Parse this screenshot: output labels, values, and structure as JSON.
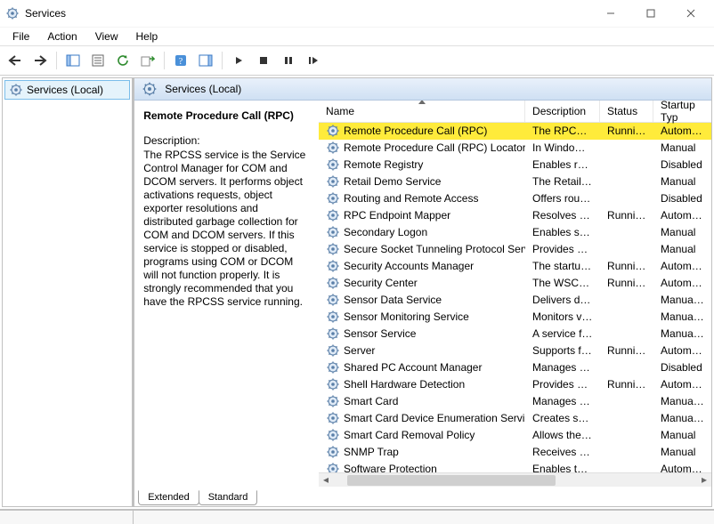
{
  "window": {
    "title": "Services"
  },
  "menu": {
    "file": "File",
    "action": "Action",
    "view": "View",
    "help": "Help"
  },
  "tree": {
    "root": "Services (Local)"
  },
  "detailHeader": {
    "label": "Services (Local)"
  },
  "info": {
    "title": "Remote Procedure Call (RPC)",
    "descLabel": "Description:",
    "descText": "The RPCSS service is the Service Control Manager for COM and DCOM servers. It performs object activations requests, object exporter resolutions and distributed garbage collection for COM and DCOM servers. If this service is stopped or disabled, programs using COM or DCOM will not function properly. It is strongly recommended that you have the RPCSS service running."
  },
  "columns": {
    "name": "Name",
    "description": "Description",
    "status": "Status",
    "startup": "Startup Typ"
  },
  "services": [
    {
      "name": "Remote Procedure Call (RPC)",
      "desc": "The RPCSS s...",
      "status": "Running",
      "startup": "Automatic",
      "selected": true
    },
    {
      "name": "Remote Procedure Call (RPC) Locator",
      "desc": "In Windows...",
      "status": "",
      "startup": "Manual"
    },
    {
      "name": "Remote Registry",
      "desc": "Enables rem...",
      "status": "",
      "startup": "Disabled"
    },
    {
      "name": "Retail Demo Service",
      "desc": "The Retail D...",
      "status": "",
      "startup": "Manual"
    },
    {
      "name": "Routing and Remote Access",
      "desc": "Offers routi...",
      "status": "",
      "startup": "Disabled"
    },
    {
      "name": "RPC Endpoint Mapper",
      "desc": "Resolves RP...",
      "status": "Running",
      "startup": "Automatic"
    },
    {
      "name": "Secondary Logon",
      "desc": "Enables star...",
      "status": "",
      "startup": "Manual"
    },
    {
      "name": "Secure Socket Tunneling Protocol Serv...",
      "desc": "Provides su...",
      "status": "",
      "startup": "Manual"
    },
    {
      "name": "Security Accounts Manager",
      "desc": "The startup ...",
      "status": "Running",
      "startup": "Automatic"
    },
    {
      "name": "Security Center",
      "desc": "The WSCSV...",
      "status": "Running",
      "startup": "Automatic"
    },
    {
      "name": "Sensor Data Service",
      "desc": "Delivers dat...",
      "status": "",
      "startup": "Manual (Tr"
    },
    {
      "name": "Sensor Monitoring Service",
      "desc": "Monitors va...",
      "status": "",
      "startup": "Manual (Tr"
    },
    {
      "name": "Sensor Service",
      "desc": "A service fo...",
      "status": "",
      "startup": "Manual (Tr"
    },
    {
      "name": "Server",
      "desc": "Supports fil...",
      "status": "Running",
      "startup": "Automatic"
    },
    {
      "name": "Shared PC Account Manager",
      "desc": "Manages pr...",
      "status": "",
      "startup": "Disabled"
    },
    {
      "name": "Shell Hardware Detection",
      "desc": "Provides no...",
      "status": "Running",
      "startup": "Automatic"
    },
    {
      "name": "Smart Card",
      "desc": "Manages ac...",
      "status": "",
      "startup": "Manual (Tr"
    },
    {
      "name": "Smart Card Device Enumeration Service",
      "desc": "Creates soft...",
      "status": "",
      "startup": "Manual (Tr"
    },
    {
      "name": "Smart Card Removal Policy",
      "desc": "Allows the s...",
      "status": "",
      "startup": "Manual"
    },
    {
      "name": "SNMP Trap",
      "desc": "Receives tra...",
      "status": "",
      "startup": "Manual"
    },
    {
      "name": "Software Protection",
      "desc": "Enables the ...",
      "status": "",
      "startup": "Automatic"
    }
  ],
  "tabs": {
    "extended": "Extended",
    "standard": "Standard"
  }
}
